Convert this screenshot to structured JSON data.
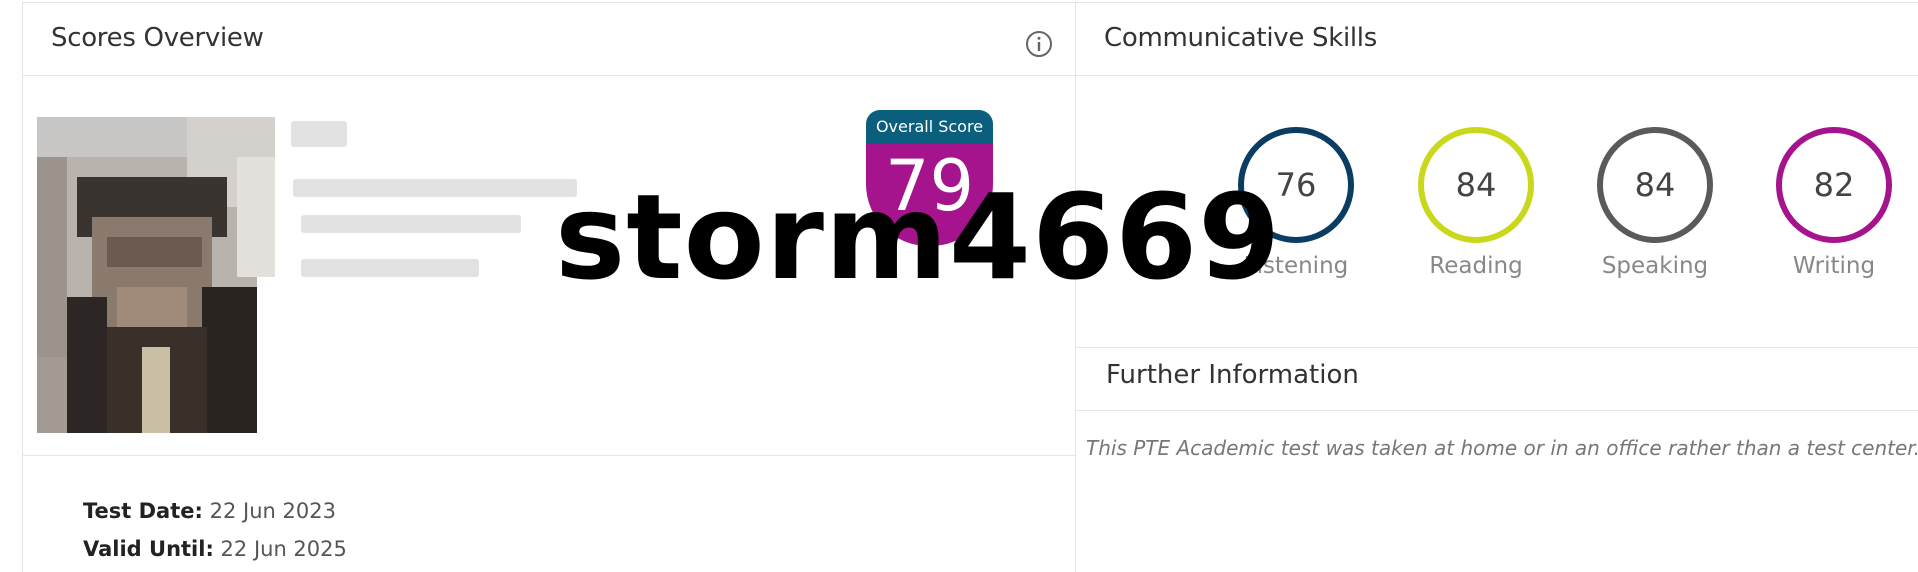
{
  "scores_overview": {
    "title": "Scores Overview",
    "info_icon": "info-circle-icon",
    "overall_score_label": "Overall Score",
    "overall_score": "79",
    "test_date_label": "Test Date:",
    "test_date": "22 Jun 2023",
    "valid_until_label": "Valid Until:",
    "valid_until": "22 Jun 2025"
  },
  "communicative_skills": {
    "title": "Communicative Skills",
    "skills": [
      {
        "label": "Listening",
        "score": "76",
        "color": "#0b3d62"
      },
      {
        "label": "Reading",
        "score": "84",
        "color": "#c9d81a"
      },
      {
        "label": "Speaking",
        "score": "84",
        "color": "#5a5a5a"
      },
      {
        "label": "Writing",
        "score": "82",
        "color": "#a5138d"
      }
    ]
  },
  "further_information": {
    "title": "Further Information",
    "text": "This PTE Academic test was taken at home or in an office rather than a test center."
  },
  "watermark": "storm4669"
}
